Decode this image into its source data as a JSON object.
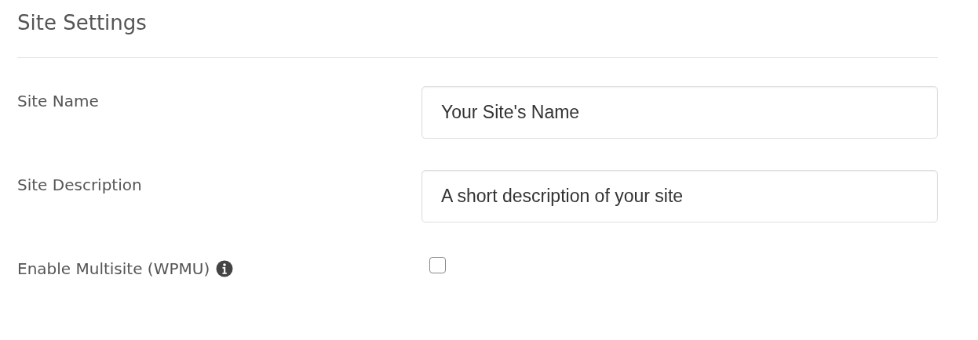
{
  "title": "Site Settings",
  "fields": [
    {
      "kind": "text",
      "label": "Site Name",
      "value": "Your Site's Name"
    },
    {
      "kind": "text",
      "label": "Site Description",
      "value": "A short description of your site"
    },
    {
      "kind": "checkbox",
      "label": "Enable Multisite (WPMU)",
      "info": true,
      "checked": false
    }
  ]
}
